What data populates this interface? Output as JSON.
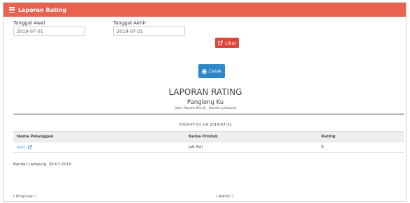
{
  "header": {
    "title": "Laporan Rating",
    "icon": "list-icon",
    "color": "#e8624f"
  },
  "filters": {
    "start_label": "Tanggal Awal",
    "start_value": "2019-07-01",
    "end_label": "Tanggal Akhir",
    "end_value": "2019-07-31",
    "view_button": "Lihat"
  },
  "print_button": "Cetak",
  "report": {
    "title": "LAPORAN RATING",
    "store": "Panglong Ku",
    "address": "Jalan Hayam Wuruk - Bandar Lampung",
    "period": "2019-07-01 s/d 2019-07-31"
  },
  "table": {
    "headers": [
      "Nama Pelanggan",
      "Nama Produk",
      "Rating"
    ],
    "rows": [
      {
        "customer": "user",
        "product": "Jati Asli",
        "rating": "5"
      }
    ]
  },
  "footer": {
    "place_date": "Bandar Lampung, 30-07-2019",
    "sign_left": "( Pimpinan )",
    "sign_right": "( Admin )"
  },
  "colors": {
    "red_button": "#e0453a",
    "blue_button": "#2d87c8",
    "link": "#2d87c8"
  }
}
